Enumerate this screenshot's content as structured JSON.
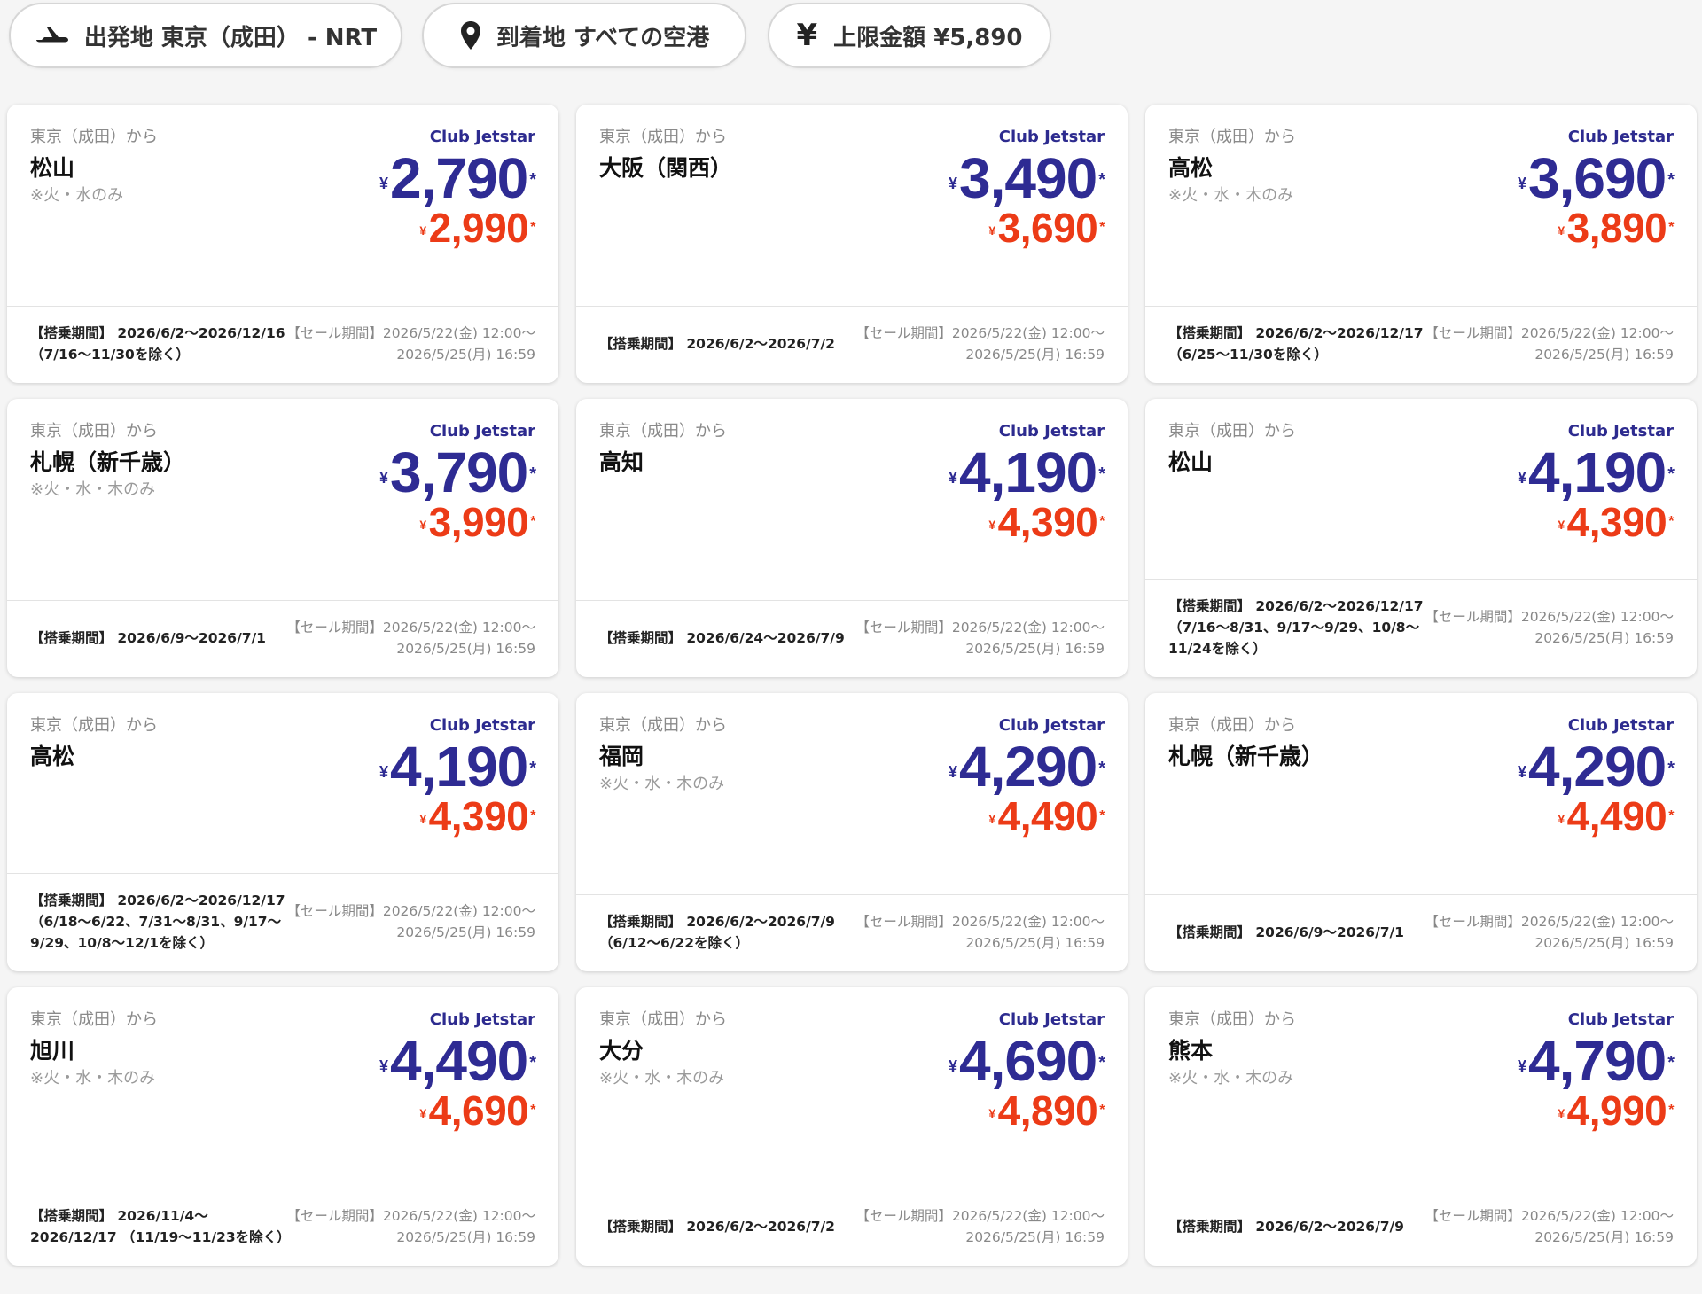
{
  "filters": {
    "origin": {
      "icon": "plane-icon",
      "label": "出発地 東京（成田） - NRT"
    },
    "destination": {
      "icon": "map-pin-icon",
      "label": "到着地 すべての空港"
    },
    "budget": {
      "icon": "yen-icon",
      "glyph": "¥",
      "label": "上限金額 ¥5,890"
    }
  },
  "colors": {
    "primary_price": "#2e2b93",
    "secondary_price": "#ec3b17",
    "club": "#2d2b8f"
  },
  "currency_symbol": "¥",
  "asterisk": "*",
  "cards": [
    {
      "origin": "東京（成田）から",
      "destination": "松山",
      "note": "※火・水のみ",
      "club_label": "Club Jetstar",
      "price_club": "2,790",
      "price_regular": "2,990",
      "period": "【搭乗期間】 2026/6/2〜2026/12/16 （7/16〜11/30を除く）",
      "sale_line1": "【セール期間】2026/5/22(金) 12:00〜",
      "sale_line2": "2026/5/25(月) 16:59"
    },
    {
      "origin": "東京（成田）から",
      "destination": "大阪（関西）",
      "note": "",
      "club_label": "Club Jetstar",
      "price_club": "3,490",
      "price_regular": "3,690",
      "period": "【搭乗期間】 2026/6/2〜2026/7/2",
      "sale_line1": "【セール期間】2026/5/22(金) 12:00〜",
      "sale_line2": "2026/5/25(月) 16:59"
    },
    {
      "origin": "東京（成田）から",
      "destination": "高松",
      "note": "※火・水・木のみ",
      "club_label": "Club Jetstar",
      "price_club": "3,690",
      "price_regular": "3,890",
      "period": "【搭乗期間】 2026/6/2〜2026/12/17 （6/25〜11/30を除く）",
      "sale_line1": "【セール期間】2026/5/22(金) 12:00〜",
      "sale_line2": "2026/5/25(月) 16:59"
    },
    {
      "origin": "東京（成田）から",
      "destination": "札幌（新千歳）",
      "note": "※火・水・木のみ",
      "club_label": "Club Jetstar",
      "price_club": "3,790",
      "price_regular": "3,990",
      "period": "【搭乗期間】 2026/6/9〜2026/7/1",
      "sale_line1": "【セール期間】2026/5/22(金) 12:00〜",
      "sale_line2": "2026/5/25(月) 16:59"
    },
    {
      "origin": "東京（成田）から",
      "destination": "高知",
      "note": "",
      "club_label": "Club Jetstar",
      "price_club": "4,190",
      "price_regular": "4,390",
      "period": "【搭乗期間】 2026/6/24〜2026/7/9",
      "sale_line1": "【セール期間】2026/5/22(金) 12:00〜",
      "sale_line2": "2026/5/25(月) 16:59"
    },
    {
      "origin": "東京（成田）から",
      "destination": "松山",
      "note": "",
      "club_label": "Club Jetstar",
      "price_club": "4,190",
      "price_regular": "4,390",
      "period": "【搭乗期間】 2026/6/2〜2026/12/17 （7/16〜8/31、9/17〜9/29、10/8〜11/24を除く）",
      "sale_line1": "【セール期間】2026/5/22(金) 12:00〜",
      "sale_line2": "2026/5/25(月) 16:59"
    },
    {
      "origin": "東京（成田）から",
      "destination": "高松",
      "note": "",
      "club_label": "Club Jetstar",
      "price_club": "4,190",
      "price_regular": "4,390",
      "period": "【搭乗期間】 2026/6/2〜2026/12/17 （6/18〜6/22、7/31〜8/31、9/17〜9/29、10/8〜12/1を除く）",
      "sale_line1": "【セール期間】2026/5/22(金) 12:00〜",
      "sale_line2": "2026/5/25(月) 16:59"
    },
    {
      "origin": "東京（成田）から",
      "destination": "福岡",
      "note": "※火・水・木のみ",
      "club_label": "Club Jetstar",
      "price_club": "4,290",
      "price_regular": "4,490",
      "period": "【搭乗期間】 2026/6/2〜2026/7/9 （6/12〜6/22を除く）",
      "sale_line1": "【セール期間】2026/5/22(金) 12:00〜",
      "sale_line2": "2026/5/25(月) 16:59"
    },
    {
      "origin": "東京（成田）から",
      "destination": "札幌（新千歳）",
      "note": "",
      "club_label": "Club Jetstar",
      "price_club": "4,290",
      "price_regular": "4,490",
      "period": "【搭乗期間】 2026/6/9〜2026/7/1",
      "sale_line1": "【セール期間】2026/5/22(金) 12:00〜",
      "sale_line2": "2026/5/25(月) 16:59"
    },
    {
      "origin": "東京（成田）から",
      "destination": "旭川",
      "note": "※火・水・木のみ",
      "club_label": "Club Jetstar",
      "price_club": "4,490",
      "price_regular": "4,690",
      "period": "【搭乗期間】 2026/11/4〜2026/12/17 （11/19〜11/23を除く）",
      "sale_line1": "【セール期間】2026/5/22(金) 12:00〜",
      "sale_line2": "2026/5/25(月) 16:59"
    },
    {
      "origin": "東京（成田）から",
      "destination": "大分",
      "note": "※火・水・木のみ",
      "club_label": "Club Jetstar",
      "price_club": "4,690",
      "price_regular": "4,890",
      "period": "【搭乗期間】 2026/6/2〜2026/7/2",
      "sale_line1": "【セール期間】2026/5/22(金) 12:00〜",
      "sale_line2": "2026/5/25(月) 16:59"
    },
    {
      "origin": "東京（成田）から",
      "destination": "熊本",
      "note": "※火・水・木のみ",
      "club_label": "Club Jetstar",
      "price_club": "4,790",
      "price_regular": "4,990",
      "period": "【搭乗期間】 2026/6/2〜2026/7/9",
      "sale_line1": "【セール期間】2026/5/22(金) 12:00〜",
      "sale_line2": "2026/5/25(月) 16:59"
    }
  ]
}
